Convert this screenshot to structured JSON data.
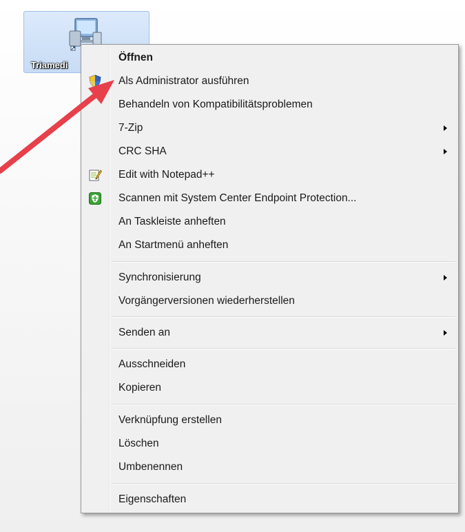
{
  "desktop_icon": {
    "label": "Triamedi"
  },
  "context_menu": {
    "items": [
      {
        "label": "Öffnen",
        "bold": true,
        "icon": "",
        "submenu": false
      },
      {
        "label": "Als Administrator ausführen",
        "icon": "uac-shield-icon",
        "submenu": false
      },
      {
        "label": "Behandeln von Kompatibilitätsproblemen",
        "icon": "",
        "submenu": false
      },
      {
        "label": "7-Zip",
        "icon": "",
        "submenu": true
      },
      {
        "label": "CRC SHA",
        "icon": "",
        "submenu": true
      },
      {
        "label": "Edit with Notepad++",
        "icon": "notepad-plus-plus-icon",
        "submenu": false
      },
      {
        "label": "Scannen mit System Center Endpoint Protection...",
        "icon": "endpoint-protection-icon",
        "submenu": false
      },
      {
        "label": "An Taskleiste anheften",
        "icon": "",
        "submenu": false
      },
      {
        "label": "An Startmenü anheften",
        "icon": "",
        "submenu": false
      },
      {
        "label": "Synchronisierung",
        "icon": "",
        "submenu": true
      },
      {
        "label": "Vorgängerversionen wiederherstellen",
        "icon": "",
        "submenu": false
      },
      {
        "label": "Senden an",
        "icon": "",
        "submenu": true
      },
      {
        "label": "Ausschneiden",
        "icon": "",
        "submenu": false
      },
      {
        "label": "Kopieren",
        "icon": "",
        "submenu": false
      },
      {
        "label": "Verknüpfung erstellen",
        "icon": "",
        "submenu": false
      },
      {
        "label": "Löschen",
        "icon": "",
        "submenu": false
      },
      {
        "label": "Umbenennen",
        "icon": "",
        "submenu": false
      },
      {
        "label": "Eigenschaften",
        "icon": "",
        "submenu": false
      }
    ]
  },
  "annotation": {
    "color": "#e8404a",
    "icon": "red-arrow-icon"
  }
}
